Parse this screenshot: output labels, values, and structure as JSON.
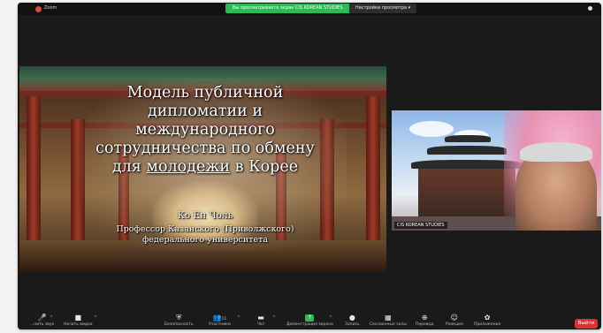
{
  "window": {
    "title": "Zoom"
  },
  "topbar": {
    "share_banner": "Вы просматриваете экран CIS KOREAN STUDIES",
    "view_settings": "Настройки просмотра ▾"
  },
  "slide": {
    "title_lines": [
      "Модель публичной",
      "дипломатии и",
      "международного",
      "сотрудничества по обмену"
    ],
    "title_last_pre": "для ",
    "title_last_underlined": "молодежи",
    "title_last_post": " в Корее",
    "author": "Ко Ен Чоль",
    "affiliation_line1": "Профессор Казанского (Приволжского)",
    "affiliation_line2": "федерального университета"
  },
  "video": {
    "participant_name": "CIS KOREAN STUDIES"
  },
  "toolbar": {
    "items": [
      {
        "icon": "microphone-icon",
        "glyph": "🎤",
        "label": "...нить звук"
      },
      {
        "icon": "video-camera-icon",
        "glyph": "■",
        "label": "Начать видео"
      },
      {
        "icon": "shield-icon",
        "glyph": "⛨",
        "label": "Безопасность"
      },
      {
        "icon": "participants-icon",
        "glyph": "👥",
        "label": "Участники",
        "count": "11"
      },
      {
        "icon": "chat-icon",
        "glyph": "▬",
        "label": "Чат"
      },
      {
        "icon": "share-screen-icon",
        "glyph": "↑",
        "label": "Демонстрация экрана"
      },
      {
        "icon": "record-icon",
        "glyph": "●",
        "label": "Запись"
      },
      {
        "icon": "breakout-rooms-icon",
        "glyph": "▦",
        "label": "Сессионные залы"
      },
      {
        "icon": "interpretation-icon",
        "glyph": "⊕",
        "label": "Перевод"
      },
      {
        "icon": "reactions-icon",
        "glyph": "☺",
        "label": "Реакция"
      },
      {
        "icon": "apps-icon",
        "glyph": "✿",
        "label": "Приложения"
      }
    ],
    "leave_label": "Выйти"
  },
  "colors": {
    "share_banner": "#2fb856",
    "leave": "#e0312f",
    "background": "#1a1a1a"
  }
}
